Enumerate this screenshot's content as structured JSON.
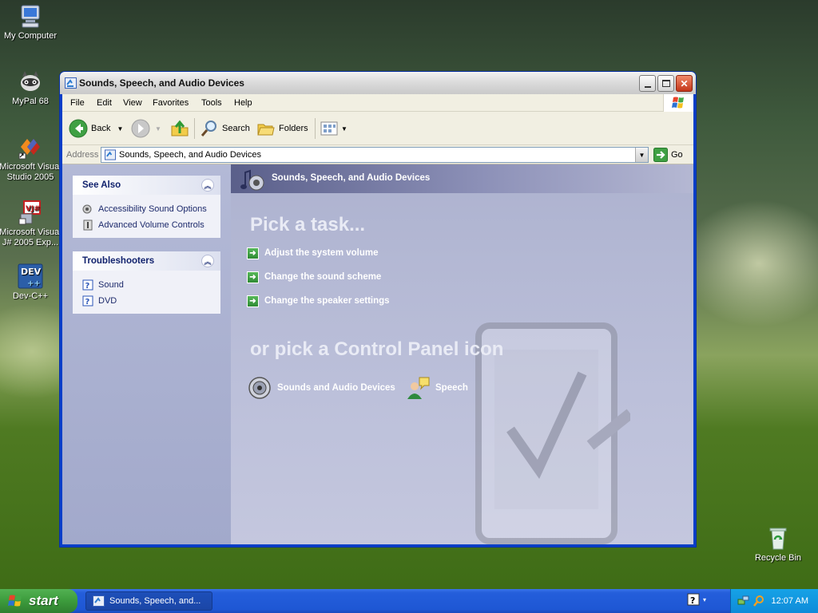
{
  "desktop": {
    "icons": [
      {
        "label": "My Computer"
      },
      {
        "label": "MyPal 68"
      },
      {
        "label": "Microsoft Visual Studio 2005"
      },
      {
        "label": "Microsoft Visual J# 2005 Exp..."
      },
      {
        "label": "Dev-C++"
      },
      {
        "label": "Recycle Bin"
      }
    ]
  },
  "window": {
    "title": "Sounds, Speech, and Audio Devices",
    "menu": [
      "File",
      "Edit",
      "View",
      "Favorites",
      "Tools",
      "Help"
    ],
    "toolbar": {
      "back": "Back",
      "search": "Search",
      "folders": "Folders"
    },
    "address": {
      "label": "Address",
      "value": "Sounds, Speech, and Audio Devices",
      "go": "Go"
    },
    "sidebar": {
      "see_also": {
        "title": "See Also",
        "items": [
          "Accessibility Sound Options",
          "Advanced Volume Controls"
        ]
      },
      "troubleshooters": {
        "title": "Troubleshooters",
        "items": [
          "Sound",
          "DVD"
        ]
      }
    },
    "main": {
      "header": "Sounds, Speech, and Audio Devices",
      "pick_task": "Pick a task...",
      "tasks": [
        "Adjust the system volume",
        "Change the sound scheme",
        "Change the speaker settings"
      ],
      "pick_icon": "or pick a Control Panel icon",
      "icons": [
        "Sounds and Audio Devices",
        "Speech"
      ]
    }
  },
  "taskbar": {
    "start": "start",
    "task_button": "Sounds, Speech, and...",
    "clock": "12:07 AM"
  },
  "colors": {
    "xp_blue": "#0a3fc8",
    "taskpane_blue": "#11226d",
    "task_green": "#2e8a34",
    "start_green": "#3c9b3c"
  }
}
